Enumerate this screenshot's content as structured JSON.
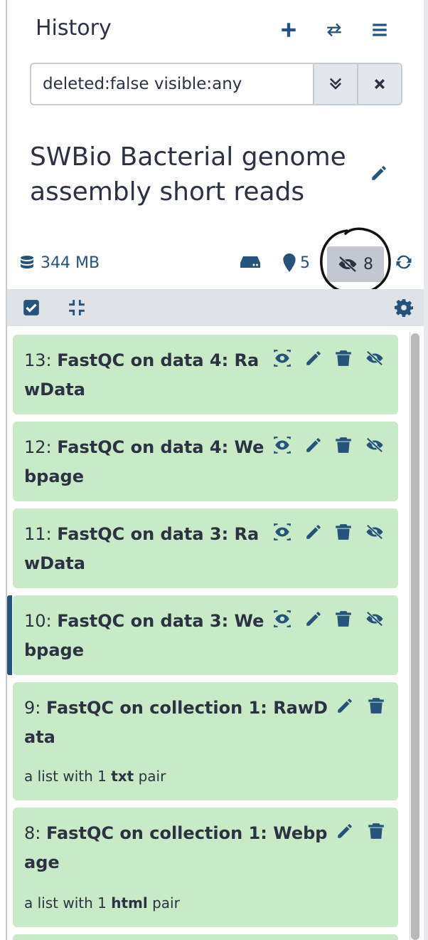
{
  "header": {
    "title": "History",
    "add_icon": "plus-icon",
    "switch_icon": "exchange-icon",
    "menu_icon": "bars-icon"
  },
  "filter": {
    "value": "deleted:false visible:any",
    "advanced_icon": "angle-double-down-icon",
    "clear_icon": "times-icon"
  },
  "history": {
    "name": "SWBio Bacterial genome assembly short reads"
  },
  "stats": {
    "size": "344 MB",
    "shown": "5",
    "hidden": "8"
  },
  "items": [
    {
      "hid": "13:",
      "name": "FastQC on data 4: RawData",
      "subtitle": null,
      "kind": "dataset"
    },
    {
      "hid": "12:",
      "name": "FastQC on data 4: Webpage",
      "subtitle": null,
      "kind": "dataset"
    },
    {
      "hid": "11:",
      "name": "FastQC on data 3: RawData",
      "subtitle": null,
      "kind": "dataset"
    },
    {
      "hid": "10:",
      "name": "FastQC on data 3: Webpage",
      "subtitle": null,
      "kind": "dataset"
    },
    {
      "hid": "9:",
      "name": "FastQC on collection 1: RawData",
      "subtitle_pre": "a list with 1 ",
      "subtitle_bold": "txt",
      "subtitle_post": " pair",
      "kind": "collection"
    },
    {
      "hid": "8:",
      "name": "FastQC on collection 1: Webpage",
      "subtitle_pre": "a list with 1 ",
      "subtitle_bold": "html",
      "subtitle_post": " pair",
      "kind": "collection"
    }
  ],
  "colors": {
    "accent": "#25537b",
    "item_ok": "#c9eac6",
    "toolbar": "#dfe2e7"
  }
}
